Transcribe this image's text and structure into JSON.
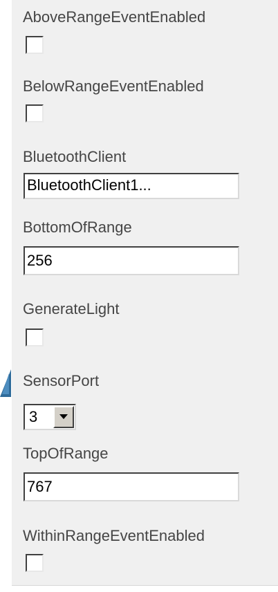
{
  "properties": {
    "above_range_label": "AboveRangeEventEnabled",
    "above_range_checked": false,
    "below_range_label": "BelowRangeEventEnabled",
    "below_range_checked": false,
    "bluetooth_label": "BluetoothClient",
    "bluetooth_value": "BluetoothClient1...",
    "bottom_label": "BottomOfRange",
    "bottom_value": "256",
    "generate_light_label": "GenerateLight",
    "generate_light_checked": false,
    "sensor_port_label": "SensorPort",
    "sensor_port_value": "3",
    "top_label": "TopOfRange",
    "top_value": "767",
    "within_range_label": "WithinRangeEventEnabled",
    "within_range_checked": false
  },
  "colors": {
    "panel_bg": "#f0f0f0",
    "label_text": "#454545",
    "pointer_arrow": "#2f6b9a"
  },
  "icons": {
    "dropdown": "triangle-down-icon",
    "pointer": "arrow-pointer-icon"
  }
}
